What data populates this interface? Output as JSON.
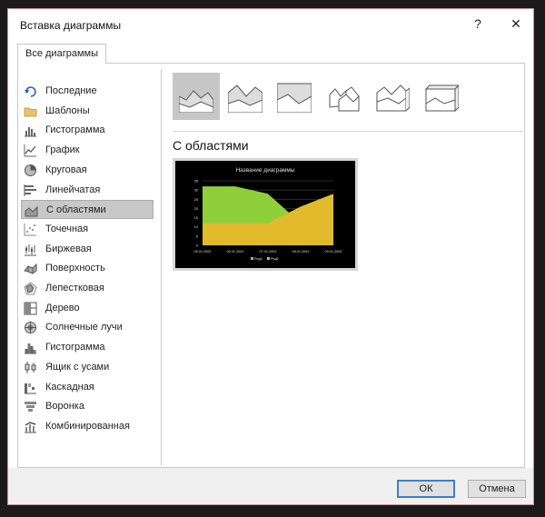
{
  "window": {
    "title": "Вставка диаграммы",
    "help_label": "?",
    "close_label": "✕"
  },
  "tabs": [
    {
      "label": "Все диаграммы"
    }
  ],
  "chart_types": [
    {
      "label": "Последние",
      "icon": "recent-icon"
    },
    {
      "label": "Шаблоны",
      "icon": "folder-icon"
    },
    {
      "label": "Гистограмма",
      "icon": "column-chart-icon"
    },
    {
      "label": "График",
      "icon": "line-chart-icon"
    },
    {
      "label": "Круговая",
      "icon": "pie-chart-icon"
    },
    {
      "label": "Линейчатая",
      "icon": "bar-chart-icon"
    },
    {
      "label": "С областями",
      "icon": "area-chart-icon",
      "selected": true
    },
    {
      "label": "Точечная",
      "icon": "scatter-chart-icon"
    },
    {
      "label": "Биржевая",
      "icon": "stock-chart-icon"
    },
    {
      "label": "Поверхность",
      "icon": "surface-chart-icon"
    },
    {
      "label": "Лепестковая",
      "icon": "radar-chart-icon"
    },
    {
      "label": "Дерево",
      "icon": "treemap-chart-icon"
    },
    {
      "label": "Солнечные лучи",
      "icon": "sunburst-chart-icon"
    },
    {
      "label": "Гистограмма",
      "icon": "histogram-chart-icon"
    },
    {
      "label": "Ящик с усами",
      "icon": "box-whisker-chart-icon"
    },
    {
      "label": "Каскадная",
      "icon": "waterfall-chart-icon"
    },
    {
      "label": "Воронка",
      "icon": "funnel-chart-icon"
    },
    {
      "label": "Комбинированная",
      "icon": "combo-chart-icon"
    }
  ],
  "subtypes": [
    {
      "icon": "area-subtype-icon",
      "selected": true
    },
    {
      "icon": "stacked-area-subtype-icon"
    },
    {
      "icon": "percent-stacked-area-subtype-icon"
    },
    {
      "icon": "3d-area-subtype-icon"
    },
    {
      "icon": "3d-stacked-area-subtype-icon"
    },
    {
      "icon": "3d-percent-stacked-area-subtype-icon"
    }
  ],
  "section_title": "С областями",
  "preview": {
    "chart_title": "Название диаграммы",
    "y_ticks": [
      "0",
      "5",
      "10",
      "15",
      "20",
      "25",
      "30",
      "35"
    ],
    "x_ticks": [
      "05.01.2002",
      "06.01.2002",
      "07.01.2002",
      "08.01.2002",
      "09.01.2002"
    ],
    "legend": [
      "Ряд1",
      "Ряд2"
    ],
    "colors": {
      "background": "#000000",
      "series1": "#8fcf3b",
      "series2": "#e2bb2d",
      "grid": "#555555",
      "text": "#dddddd"
    }
  },
  "chart_data": {
    "type": "area",
    "title": "Название диаграммы",
    "categories": [
      "05.01.2002",
      "06.01.2002",
      "07.01.2002",
      "08.01.2002",
      "09.01.2002"
    ],
    "ylim": [
      0,
      35
    ],
    "series": [
      {
        "name": "Ряд1",
        "values": [
          32,
          32,
          28,
          12,
          15
        ]
      },
      {
        "name": "Ряд2",
        "values": [
          12,
          12,
          12,
          21,
          28
        ]
      }
    ],
    "legend_position": "bottom"
  },
  "buttons": {
    "ok": "ОК",
    "cancel": "Отмена"
  }
}
